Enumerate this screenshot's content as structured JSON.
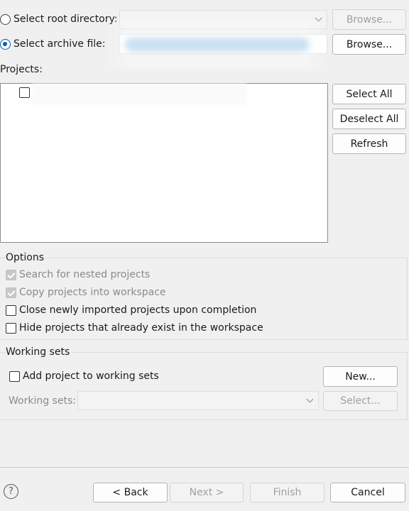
{
  "source": {
    "root_directory_label": "Select root directory:",
    "root_browse_label": "Browse...",
    "archive_file_label": "Select archive file:",
    "archive_browse_label": "Browse..."
  },
  "projects": {
    "label": "Projects:",
    "select_all_label": "Select All",
    "deselect_all_label": "Deselect All",
    "refresh_label": "Refresh"
  },
  "options": {
    "title": "Options",
    "search_nested_label": "Search for nested projects",
    "copy_projects_label": "Copy projects into workspace",
    "close_imported_label": "Close newly imported projects upon completion",
    "hide_existing_label": "Hide projects that already exist in the workspace"
  },
  "working_sets": {
    "title": "Working sets",
    "add_label": "Add project to working sets",
    "new_button_label": "New...",
    "sets_label": "Working sets:",
    "select_button_label": "Select..."
  },
  "footer": {
    "help_glyph": "?",
    "back_label": "< Back",
    "next_label": "Next >",
    "finish_label": "Finish",
    "cancel_label": "Cancel"
  },
  "colors": {
    "accent": "#005fb8",
    "blurred_path": "#8fc4ec"
  }
}
